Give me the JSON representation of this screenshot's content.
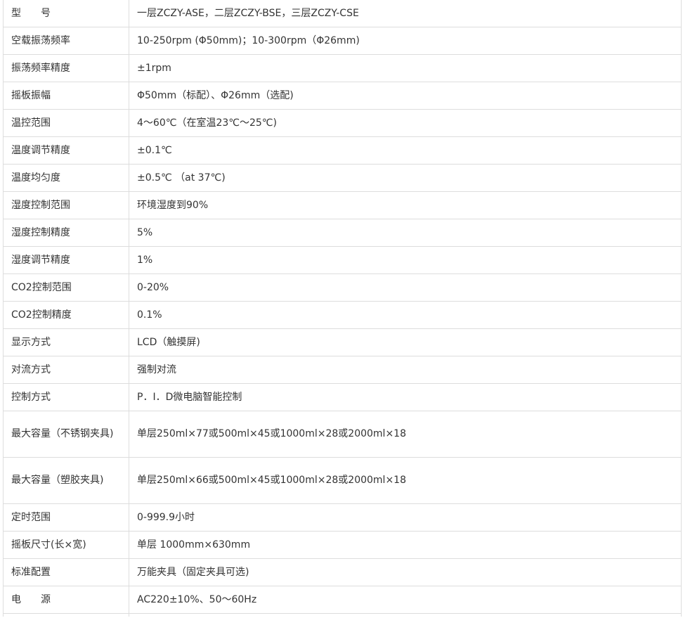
{
  "specs": [
    {
      "label": "型　　号",
      "value": "一层ZCZY-ASE，二层ZCZY-BSE，三层ZCZY-CSE"
    },
    {
      "label": "空载振荡频率",
      "value": "10-250rpm (Φ50mm)；10-300rpm（Φ26mm)"
    },
    {
      "label": "振荡频率精度",
      "value": "±1rpm"
    },
    {
      "label": "摇板振幅",
      "value": "Φ50mm（标配）、Φ26mm（选配)"
    },
    {
      "label": "温控范围",
      "value": "4～60℃（在室温23℃～25℃)"
    },
    {
      "label": "温度调节精度",
      "value": "±0.1℃"
    },
    {
      "label": "温度均匀度",
      "value": "±0.5℃ （at 37℃)"
    },
    {
      "label": "湿度控制范围",
      "value": "环境湿度到90%"
    },
    {
      "label": "湿度控制精度",
      "value": "5%"
    },
    {
      "label": "湿度调节精度",
      "value": "1%"
    },
    {
      "label": "CO2控制范围",
      "value": "0-20%"
    },
    {
      "label": "CO2控制精度",
      "value": "0.1%"
    },
    {
      "label": "显示方式",
      "value": "LCD（触摸屏)"
    },
    {
      "label": "对流方式",
      "value": "强制对流"
    },
    {
      "label": "控制方式",
      "value": "P．I．D微电脑智能控制"
    },
    {
      "label": "最大容量（不锈钢夹具)",
      "value": "单层250ml×77或500ml×45或1000ml×28或2000ml×18"
    },
    {
      "label": "最大容量（塑胶夹具)",
      "value": "单层250ml×66或500ml×45或1000ml×28或2000ml×18"
    },
    {
      "label": "定时范围",
      "value": "0-999.9小时"
    },
    {
      "label": "摇板尺寸(长×宽)",
      "value": "单层 1000mm×630mm"
    },
    {
      "label": "标准配置",
      "value": "万能夹具（固定夹具可选)"
    },
    {
      "label": "电　　源",
      "value": "AC220±10%、50～60Hz"
    }
  ]
}
